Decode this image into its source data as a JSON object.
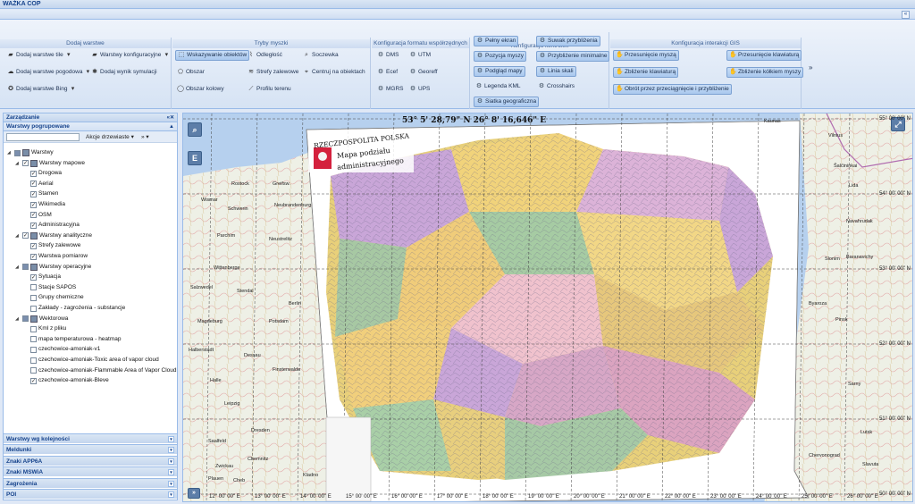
{
  "app": {
    "title": "WAŻKA COP",
    "collapse_glyph": "«"
  },
  "ribbon": {
    "groups": [
      {
        "title": "Dodaj warstwe",
        "buttons": [
          "Dodaj warstwe tile",
          "Warstwy konfiguracyjne",
          "Dodaj warstwe pogodowa",
          "Dodaj wynik symulacji",
          "Dodaj warstwe Bing"
        ]
      },
      {
        "title": "Tryby myszki",
        "buttons": [
          "Wskazywanie obiektów",
          "Odległość",
          "Soczewka",
          "Obszar",
          "Strefy zalewowe",
          "Centruj na obiektach",
          "Obszar kolowy",
          "Profilu terenu"
        ]
      },
      {
        "title": "Konfiguracja formatu współrzędnych",
        "buttons": [
          "DMS",
          "UTM",
          "Ecef",
          "Georeff",
          "MGRS",
          "UPS"
        ]
      },
      {
        "title": "Konfiguracja kontrolek",
        "buttons": [
          "Pełny ekran",
          "Suwak przybliżenia",
          "Pozycja myszy",
          "Przybliżenie minimalne",
          "Podgląd mapy",
          "Linia skali",
          "Legenda KML",
          "Crosshairs",
          "Siatka geograficzna"
        ]
      },
      {
        "title": "Konfiguracja interakcji GIS",
        "buttons": [
          "Przesunięcie myszą",
          "Przesunięcie klawiaturą",
          "Zbliżenie klawiaturą",
          "Zbliżenie kółkiem myszy",
          "Obrót przez przeciągnięcie i przybliżenie"
        ]
      }
    ],
    "more": "»"
  },
  "panel": {
    "title": "Zarządzanie",
    "section": "Warstwy pogrupowane",
    "filter_placeholder": "",
    "action": "Akcje drzewiaste ▾",
    "more": "» ▾",
    "tree": [
      {
        "label": "Warstwy",
        "level": 0,
        "state": "part"
      },
      {
        "label": "Warstwy mapowe",
        "level": 1,
        "state": "on"
      },
      {
        "label": "Drogowa",
        "level": 2,
        "state": "on"
      },
      {
        "label": "Aerial",
        "level": 2,
        "state": "on"
      },
      {
        "label": "Stamen",
        "level": 2,
        "state": "on"
      },
      {
        "label": "Wikimedia",
        "level": 2,
        "state": "on"
      },
      {
        "label": "OSM",
        "level": 2,
        "state": "on"
      },
      {
        "label": "Administracyjna",
        "level": 2,
        "state": "on"
      },
      {
        "label": "Warstwy analityczne",
        "level": 1,
        "state": "on"
      },
      {
        "label": "Strefy zalewowe",
        "level": 2,
        "state": "on"
      },
      {
        "label": "Warstwa pomiarow",
        "level": 2,
        "state": "on"
      },
      {
        "label": "Warstwy operacyjne",
        "level": 1,
        "state": "part"
      },
      {
        "label": "Sytuacja",
        "level": 2,
        "state": "on"
      },
      {
        "label": "Stacje SAPOS",
        "level": 2,
        "state": "off"
      },
      {
        "label": "Grupy chemiczne",
        "level": 2,
        "state": "off"
      },
      {
        "label": "Zakłady - zagrożenia - substancje",
        "level": 2,
        "state": "off"
      },
      {
        "label": "Wektorowa",
        "level": 1,
        "state": "part"
      },
      {
        "label": "Kml z pliku",
        "level": 2,
        "state": "off"
      },
      {
        "label": "mapa temperaturowa - heatmap",
        "level": 2,
        "state": "off"
      },
      {
        "label": "czechowice-amoniak-v1",
        "level": 2,
        "state": "off"
      },
      {
        "label": "czechowice-amoniak-Toxic area of vapor cloud",
        "level": 2,
        "state": "off"
      },
      {
        "label": "czechowice-amoniak-Flammable Area of Vapor Cloud",
        "level": 2,
        "state": "off"
      },
      {
        "label": "czechowice-amoniak-Bleve",
        "level": 2,
        "state": "on"
      }
    ],
    "accordion": [
      "Warstwy wg kolejności",
      "Meldunki",
      "Znaki APP6A",
      "Znaki MSWiA",
      "Zagrożenia",
      "POI"
    ]
  },
  "map": {
    "coords": "53° 5' 28,79\" N 26° 8' 16,646\" E",
    "sheet_title_1": "RZECZPOSPOLITA POLSKA",
    "sheet_title_2": "Mapa podziału",
    "sheet_title_3": "administracyjnego",
    "lat_labels": [
      "55° 00' 00\" N",
      "54° 00' 00\" N",
      "53° 00' 00\" N",
      "52° 00' 00\" N",
      "51° 00' 00\" N",
      "50° 00' 00\" N"
    ],
    "lon_labels": [
      "12° 00' 00\" E",
      "13° 00' 00\" E",
      "14° 00' 00\" E",
      "15° 00' 00\" E",
      "16° 00' 00\" E",
      "17° 00' 00\" E",
      "18° 00' 00\" E",
      "19° 00' 00\" E",
      "20° 00' 00\" E",
      "21° 00' 00\" E",
      "22° 00' 00\" E",
      "23° 00' 00\" E",
      "24° 00' 00\" E",
      "25° 00' 00\" E",
      "26° 00' 00\" E"
    ],
    "cities": [
      "Kaunas",
      "Vilnius",
      "Šalčininkai",
      "Lida",
      "Navahrudak",
      "Baranavichy",
      "Slonim",
      "Byaroza",
      "Pinsk",
      "Lutsk",
      "Sarny",
      "Chervonograd",
      "Slavuta",
      "Rostock",
      "Greifsw.",
      "Wismar",
      "Neubrandenburg",
      "Schwerin",
      "Neustrelitz",
      "Parchim",
      "Wittenberge",
      "Salzwedel",
      "Stendal",
      "Berlin",
      "Potsdam",
      "Magdeburg",
      "Dessau",
      "Halberstadt",
      "Finsterwalde",
      "Halle",
      "Leipzig",
      "Saalfeld",
      "Dresden",
      "Chemnitz",
      "Zwickau",
      "Plauen",
      "Cheb",
      "Kladno"
    ],
    "zoom_icon": "search-icon",
    "panel_icon": "E"
  },
  "colors": {
    "accent": "#15428b",
    "header": "#c4d6ee",
    "border": "#99bbe8"
  }
}
